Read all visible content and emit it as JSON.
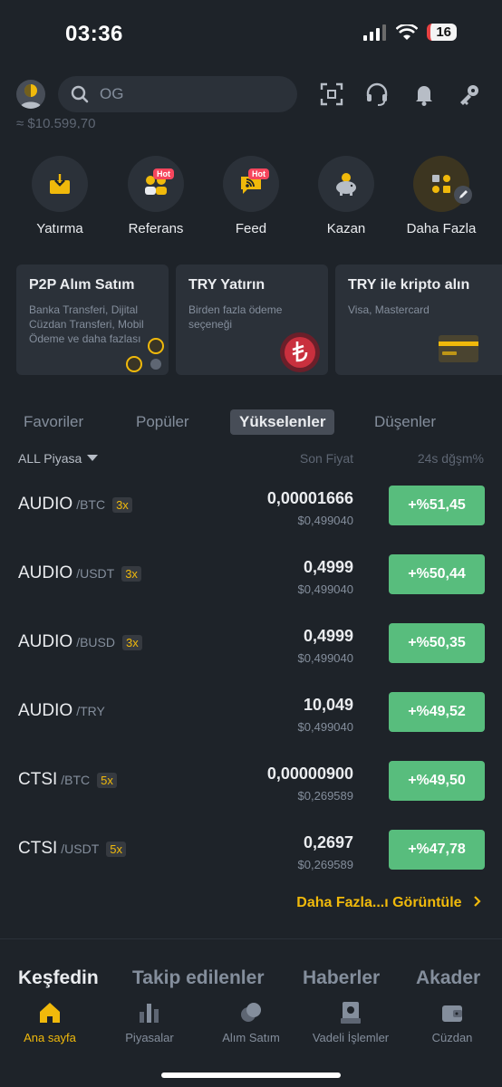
{
  "status_bar": {
    "time": "03:36",
    "battery": "16"
  },
  "search": {
    "placeholder": "OG"
  },
  "balance": "≈ $10.599,70",
  "shortcuts": [
    {
      "label": "Yatırma",
      "icon": "deposit-icon"
    },
    {
      "label": "Referans",
      "icon": "referral-icon",
      "badge": "Hot"
    },
    {
      "label": "Feed",
      "icon": "feed-icon",
      "badge": "Hot"
    },
    {
      "label": "Kazan",
      "icon": "piggy-bank-icon"
    },
    {
      "label": "Daha Fazla",
      "icon": "more-apps-icon"
    }
  ],
  "cards": [
    {
      "title": "P2P Alım Satım",
      "subtitle": "Banka Transferi, Dijital Cüzdan Transferi, Mobil Ödeme ve daha fazlası"
    },
    {
      "title": "TRY Yatırın",
      "subtitle": "Birden fazla ödeme seçeneği"
    },
    {
      "title": "TRY ile kripto alın",
      "subtitle": "Visa, Mastercard"
    }
  ],
  "tabs": [
    {
      "label": "Favoriler"
    },
    {
      "label": "Popüler"
    },
    {
      "label": "Yükselenler",
      "active": true
    },
    {
      "label": "Düşenler"
    }
  ],
  "table": {
    "filter": "ALL Piyasa",
    "col_price": "Son Fiyat",
    "col_change": "24s dğşm%",
    "rows": [
      {
        "base": "AUDIO",
        "quote": "/BTC",
        "leverage": "3x",
        "price": "0,00001666",
        "usd": "$0,499040",
        "change": "+%51,45"
      },
      {
        "base": "AUDIO",
        "quote": "/USDT",
        "leverage": "3x",
        "price": "0,4999",
        "usd": "$0,499040",
        "change": "+%50,44"
      },
      {
        "base": "AUDIO",
        "quote": "/BUSD",
        "leverage": "3x",
        "price": "0,4999",
        "usd": "$0,499040",
        "change": "+%50,35"
      },
      {
        "base": "AUDIO",
        "quote": "/TRY",
        "leverage": "",
        "price": "10,049",
        "usd": "$0,499040",
        "change": "+%49,52"
      },
      {
        "base": "CTSI",
        "quote": "/BTC",
        "leverage": "5x",
        "price": "0,00000900",
        "usd": "$0,269589",
        "change": "+%49,50"
      },
      {
        "base": "CTSI",
        "quote": "/USDT",
        "leverage": "5x",
        "price": "0,2697",
        "usd": "$0,269589",
        "change": "+%47,78"
      }
    ]
  },
  "view_more": "Daha Fazla...ı Görüntüle",
  "feed_tabs": [
    {
      "label": "Keşfedin",
      "active": true
    },
    {
      "label": "Takip edilenler"
    },
    {
      "label": "Haberler"
    },
    {
      "label": "Akader"
    }
  ],
  "nav": [
    {
      "label": "Ana sayfa",
      "active": true
    },
    {
      "label": "Piyasalar"
    },
    {
      "label": "Alım Satım"
    },
    {
      "label": "Vadeli İşlemler"
    },
    {
      "label": "Cüzdan"
    }
  ],
  "colors": {
    "bg": "#1e2329",
    "accent": "#f0b90b",
    "up": "#58bd7d",
    "hot": "#f6465d"
  }
}
